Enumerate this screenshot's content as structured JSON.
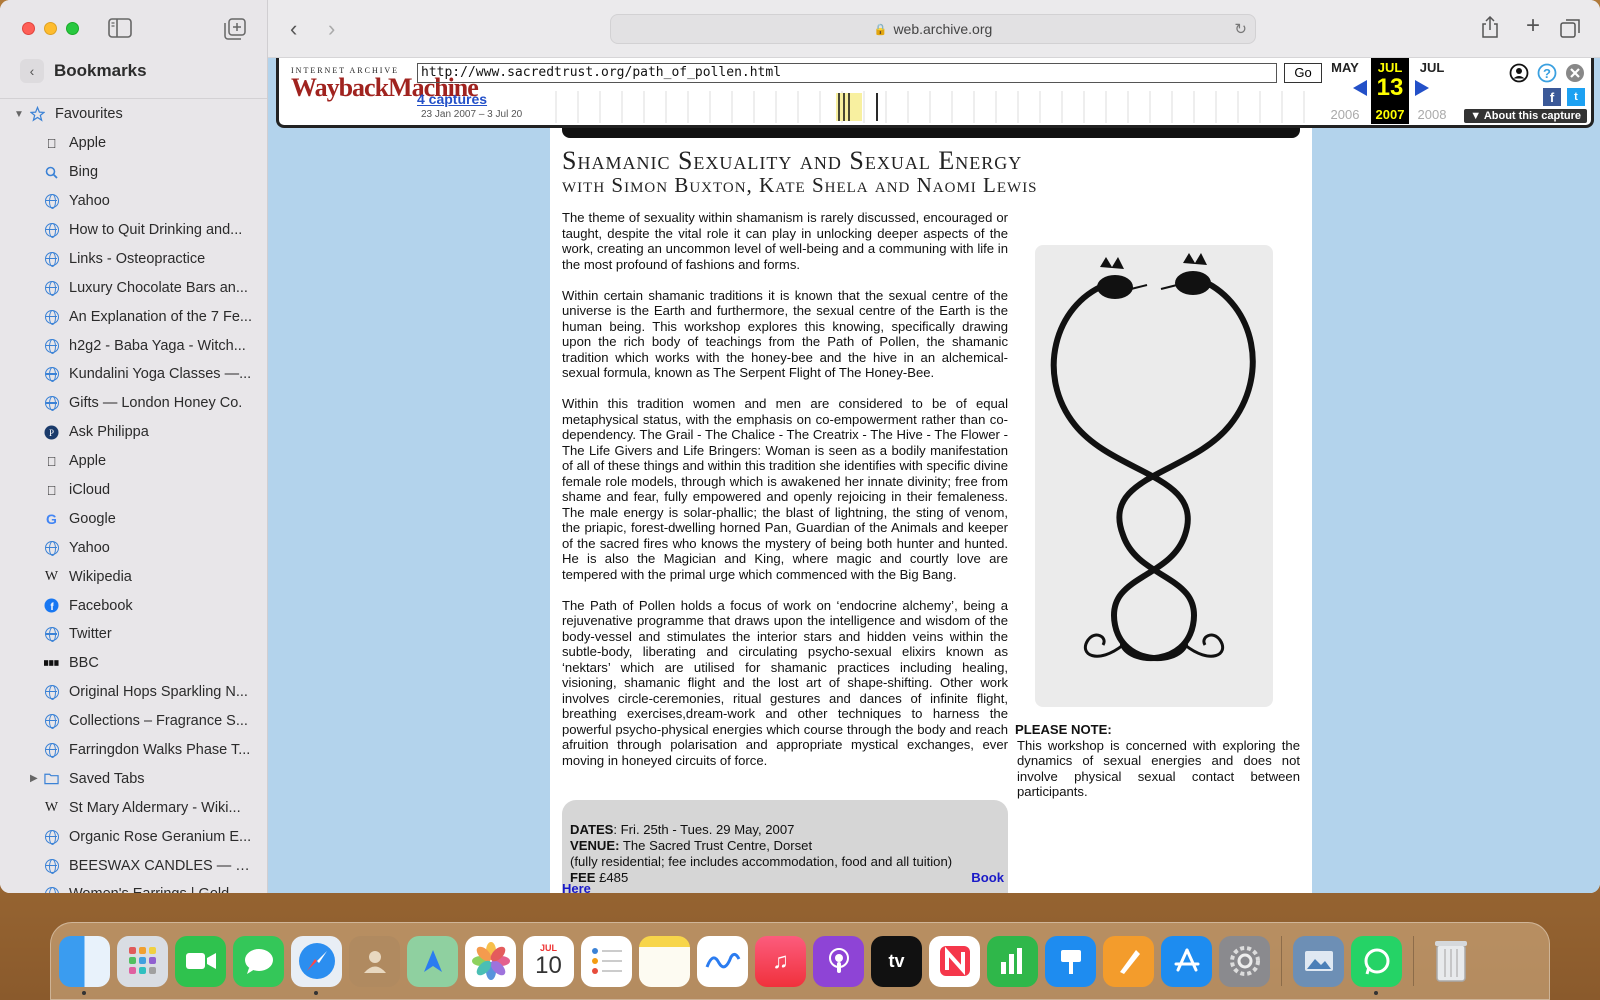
{
  "browser": {
    "address": "web.archive.org"
  },
  "sidebar": {
    "title": "Bookmarks",
    "favourites_label": "Favourites",
    "items": [
      {
        "label": "Apple",
        "icon": "apple-icon"
      },
      {
        "label": "Bing",
        "icon": "bing-search-icon"
      },
      {
        "label": "Yahoo",
        "icon": "globe-icon"
      },
      {
        "label": "How to Quit Drinking and...",
        "icon": "globe-icon"
      },
      {
        "label": "Links - Osteopractice",
        "icon": "globe-icon"
      },
      {
        "label": "Luxury Chocolate Bars an...",
        "icon": "globe-icon"
      },
      {
        "label": "An Explanation of the 7 Fe...",
        "icon": "globe-icon"
      },
      {
        "label": "h2g2 - Baba Yaga - Witch...",
        "icon": "globe-icon"
      },
      {
        "label": "Kundalini Yoga Classes —...",
        "icon": "globe-icon"
      },
      {
        "label": "Gifts — London Honey Co.",
        "icon": "globe-icon"
      },
      {
        "label": "Ask Philippa",
        "icon": "philippa-icon"
      },
      {
        "label": "Apple",
        "icon": "apple-icon"
      },
      {
        "label": "iCloud",
        "icon": "apple-icon"
      },
      {
        "label": "Google",
        "icon": "google-icon"
      },
      {
        "label": "Yahoo",
        "icon": "globe-icon"
      },
      {
        "label": "Wikipedia",
        "icon": "wikipedia-icon"
      },
      {
        "label": "Facebook",
        "icon": "facebook-icon"
      },
      {
        "label": "Twitter",
        "icon": "globe-icon"
      },
      {
        "label": "BBC",
        "icon": "bbc-icon"
      },
      {
        "label": "Original Hops Sparkling N...",
        "icon": "globe-icon"
      },
      {
        "label": "Collections – Fragrance S...",
        "icon": "globe-icon"
      },
      {
        "label": "Farringdon Walks Phase T...",
        "icon": "globe-icon"
      }
    ],
    "folder": {
      "label": "Saved Tabs"
    },
    "after_items": [
      {
        "label": "St Mary Aldermary - Wiki...",
        "icon": "wikipedia-icon"
      },
      {
        "label": "Organic Rose Geranium E...",
        "icon": "globe-icon"
      },
      {
        "label": "BEESWAX CANDLES — Pl...",
        "icon": "globe-icon"
      },
      {
        "label": "Women's Earrings | Gold...",
        "icon": "globe-icon"
      }
    ]
  },
  "wayback": {
    "brand_top": "INTERNET ARCHIVE",
    "brand_main": "WaybackMachine",
    "url": "http://www.sacredtrust.org/path_of_pollen.html",
    "go_label": "Go",
    "captures": "4 captures",
    "range": "23 Jan 2007 – 3 Jul 20",
    "prev_month": "MAY",
    "cur_month": "JUL",
    "next_month": "JUL",
    "cur_day": "13",
    "prev_year": "2006",
    "cur_year": "2007",
    "next_year": "2008",
    "about": "About this capture"
  },
  "page": {
    "title": "Shamanic Sexuality and Sexual Energy",
    "subtitle": "with Simon Buxton, Kate Shela and Naomi Lewis",
    "paragraphs": [
      "The theme of sexuality within shamanism is rarely discussed, encouraged or taught, despite the vital role it can play in unlocking deeper aspects of the work, creating an uncommon level of well-being and a communing with life in the most profound of fashions and forms.",
      "Within certain shamanic traditions it is known that the sexual centre of the universe is the Earth and furthermore, the sexual centre of the Earth is the human being. This workshop explores this knowing, specifically drawing upon the rich body of teachings from the Path of Pollen, the shamanic tradition which works with the honey-bee and the hive in an alchemical-sexual formula, known as The Serpent Flight of The Honey-Bee.",
      "Within this tradition women and men are considered to be of equal metaphysical status, with the emphasis on co-empowerment rather than co-dependency. The Grail - The Chalice - The Creatrix - The Hive - The Flower - The Life Givers and Life Bringers: Woman is seen as a bodily manifestation of all of these things and within this tradition she identifies with specific divine female role models, through which is awakened her innate divinity; free from shame and fear, fully empowered and openly rejoicing in their femaleness. The male energy is solar-phallic; the blast of lightning, the sting of venom, the priapic, forest-dwelling horned Pan, Guardian of the Animals and keeper of the sacred fires who knows the mystery of being both hunter and hunted. He is also the Magician and King, where magic and courtly love are tempered with the primal urge which commenced with the Big Bang.",
      "The Path of Pollen holds a focus of work on ‘endocrine alchemy’, being a rejuvenative programme that draws upon the intelligence and wisdom of the body-vessel and stimulates the interior stars and hidden veins within the subtle-body, liberating and circulating psycho-sexual elixirs known as ‘nektars’ which are utilised for shamanic practices including healing, visioning, shamanic flight and the lost art of shape-shifting. Other work involves circle-ceremonies, ritual gestures and dances of infinite flight, breathing exercises,dream-work and other techniques to harness the powerful psycho-physical energies which course through the body and reach afruition through polarisation and appropriate mystical exchanges, ever moving in honeyed circuits of force."
    ],
    "note_title": "PLEASE NOTE:",
    "note_text": "This workshop is concerned with exploring the dynamics of sexual energies and does not involve physical sexual contact between participants.",
    "dates_label": "DATES",
    "dates_value": ": Fri. 25th - Tues. 29 May, 2007",
    "venue_label": "VENUE:",
    "venue_value": " The Sacred Trust Centre, Dorset",
    "residential": "(fully residential; fee includes accommodation, food and all tuition)",
    "fee_label": "FEE",
    "fee_value": " £485",
    "book": "Book",
    "here": "Here"
  },
  "dock": {
    "calendar_month": "JUL",
    "calendar_day": "10",
    "apps": [
      "finder-icon",
      "launchpad-icon",
      "facetime-icon",
      "messages-icon",
      "safari-icon",
      "contacts-icon",
      "maps-icon",
      "photos-icon",
      "calendar-icon",
      "reminders-icon",
      "notes-icon",
      "freeform-icon",
      "music-icon",
      "podcasts-icon",
      "tv-icon",
      "news-icon",
      "numbers-icon",
      "keynote-icon",
      "pages-icon",
      "app-store-icon",
      "system-settings-icon",
      "preview-icon",
      "whatsapp-icon",
      "trash-icon"
    ]
  }
}
